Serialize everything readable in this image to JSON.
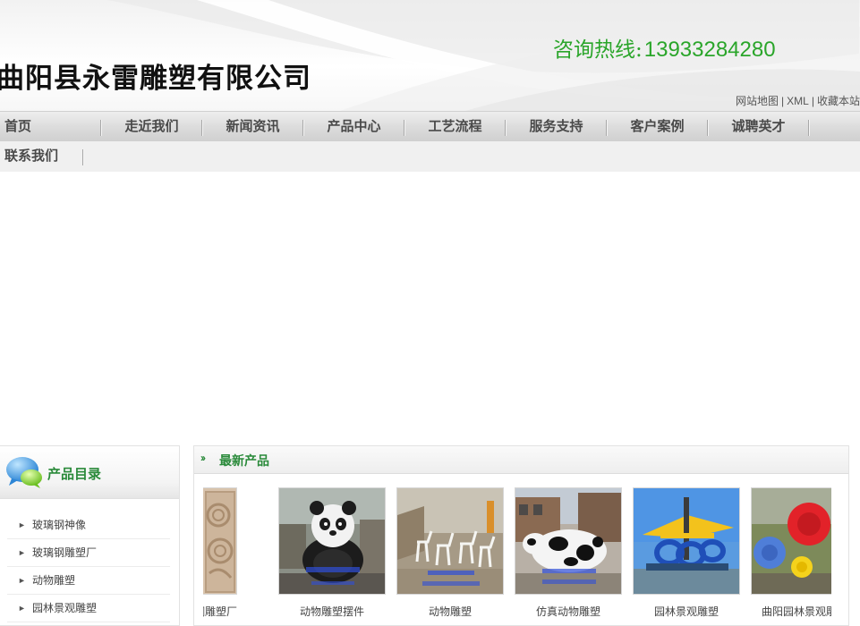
{
  "header": {
    "company_name": "曲阳县永雷雕塑有限公司",
    "hotline_label": "咨询热线:",
    "hotline_number": "13933284280",
    "top_links": [
      "网站地图",
      "XML",
      "收藏本站"
    ],
    "accent_color": "#2aa52a"
  },
  "nav": {
    "row1": [
      "首页",
      "走近我们",
      "新闻资讯",
      "产品中心",
      "工艺流程",
      "服务支持",
      "客户案例",
      "诚聘英才"
    ],
    "row2": [
      "联系我们"
    ]
  },
  "sidebar": {
    "title": "产品目录",
    "icon": "chat-bubble-icon",
    "items": [
      {
        "label": "玻璃钢神像"
      },
      {
        "label": "玻璃钢雕塑厂"
      },
      {
        "label": "动物雕塑"
      },
      {
        "label": "园林景观雕塑"
      }
    ]
  },
  "products": {
    "title": "最新产品",
    "items": [
      {
        "caption": "铜雕塑厂"
      },
      {
        "caption": "动物雕塑摆件"
      },
      {
        "caption": "动物雕塑"
      },
      {
        "caption": "仿真动物雕塑"
      },
      {
        "caption": "园林景观雕塑"
      },
      {
        "caption": "曲阳园林景观雕塑"
      }
    ]
  }
}
